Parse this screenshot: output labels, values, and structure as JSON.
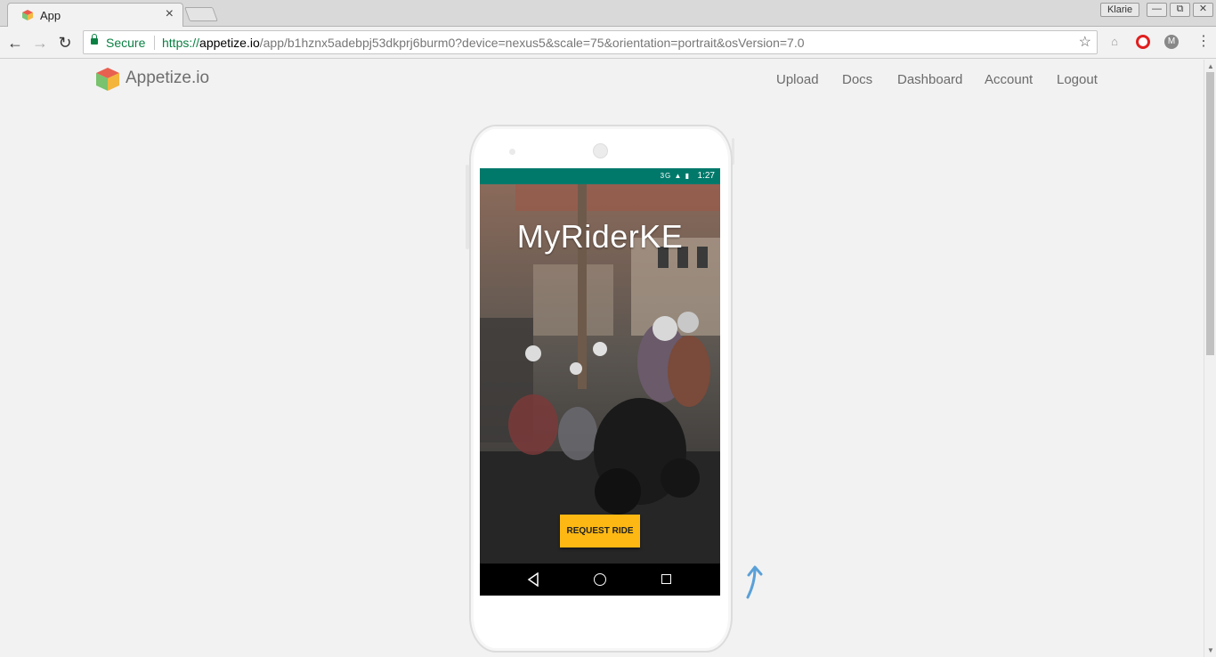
{
  "browser": {
    "tab_title": "App",
    "tab_close": "×",
    "profile_name": "Klarie",
    "window_controls": {
      "minimize": "—",
      "restore": "⧉",
      "close": "✕"
    },
    "secure_label": "Secure",
    "url": {
      "scheme": "https://",
      "host": "appetize.io",
      "path": "/app/b1hznx5adebpj53dkprj6burm0?device=nexus5&scale=75&orientation=portrait&osVersion=7.0"
    },
    "nav": {
      "back": "←",
      "forward": "→",
      "reload": "↻"
    },
    "bookmark_star": "☆",
    "menu": "⋮",
    "extensions": [
      {
        "name": "extension-icon",
        "glyph": "⌂"
      },
      {
        "name": "opera-icon",
        "glyph": "O"
      },
      {
        "name": "m-extension-icon",
        "glyph": "M"
      }
    ]
  },
  "site": {
    "brand": "Appetize.io",
    "nav_links": [
      "Upload",
      "Docs",
      "Dashboard",
      "Account",
      "Logout"
    ]
  },
  "phone": {
    "status_time": "1:27",
    "status_icons": "3G ▲ ▮",
    "app_title": "MyRiderKE",
    "request_button": "REQUEST RIDE",
    "status_color": "#00796b",
    "button_color": "#fdb813"
  }
}
